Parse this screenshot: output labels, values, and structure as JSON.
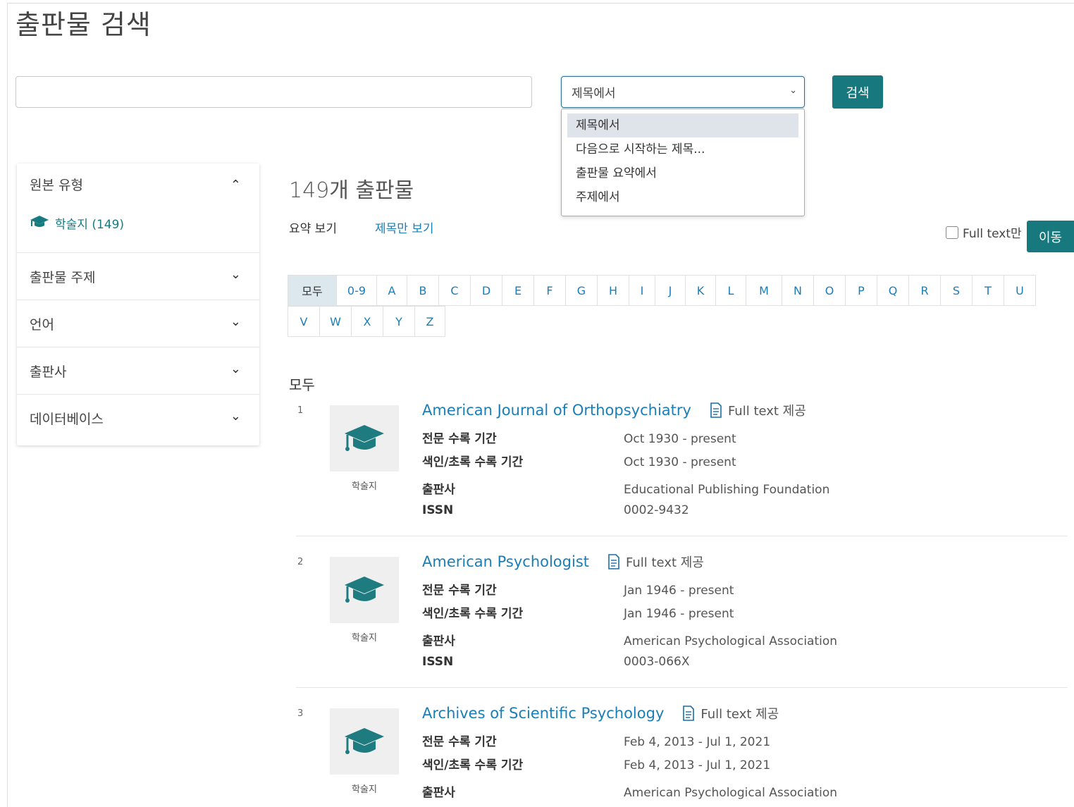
{
  "page": {
    "title": "출판물 검색"
  },
  "search": {
    "query": "",
    "scope_selected": "제목에서",
    "button_label": "검색",
    "dropdown_options": [
      "제목에서",
      "다음으로 시작하는 제목...",
      "출판물 요약에서",
      "주제에서"
    ]
  },
  "sidebar": {
    "facets": [
      {
        "label": "원본 유형",
        "state": "open",
        "items": [
          {
            "label": "학술지 (149)",
            "icon": "graduation-cap-icon"
          }
        ]
      },
      {
        "label": "출판물 주제",
        "state": "collapsed"
      },
      {
        "label": "언어",
        "state": "collapsed"
      },
      {
        "label": "출판사",
        "state": "collapsed"
      },
      {
        "label": "데이터베이스",
        "state": "collapsed"
      }
    ]
  },
  "results_header": {
    "count_text": "149개 출판물",
    "view_abstract": "요약 보기",
    "view_titles_only": "제목만 보기",
    "fulltext_only_label": "Full text만",
    "go_button": "이동"
  },
  "alphabet": {
    "row1": [
      "모두",
      "0-9",
      "A",
      "B",
      "C",
      "D",
      "E",
      "F",
      "G",
      "H",
      "I",
      "J",
      "K",
      "L",
      "M",
      "N",
      "O",
      "P",
      "Q",
      "R",
      "S",
      "T",
      "U"
    ],
    "row2": [
      "V",
      "W",
      "X",
      "Y",
      "Z"
    ],
    "active": "모두"
  },
  "section_label": "모두",
  "field_labels": {
    "fulltext_coverage": "전문 수록 기간",
    "index_coverage": "색인/초록 수록 기간",
    "publisher": "출판사",
    "issn": "ISSN",
    "thumb_label": "학술지",
    "fulltext_badge": "Full text 제공"
  },
  "results": [
    {
      "num": "1",
      "title": "American Journal of Orthopsychiatry",
      "fulltext": "Oct 1930 - present",
      "index": "Oct 1930 - present",
      "publisher": "Educational Publishing Foundation",
      "issn": "0002-9432"
    },
    {
      "num": "2",
      "title": "American Psychologist",
      "fulltext": "Jan 1946 - present",
      "index": "Jan 1946 - present",
      "publisher": "American Psychological Association",
      "issn": "0003-066X"
    },
    {
      "num": "3",
      "title": "Archives of Scientific Psychology",
      "fulltext": "Feb 4, 2013 - Jul 1, 2021",
      "index": "Feb 4, 2013 - Jul 1, 2021",
      "publisher": "American Psychological Association",
      "issn": ""
    }
  ],
  "colors": {
    "accent": "#17787e",
    "link": "#1a7eb8"
  }
}
